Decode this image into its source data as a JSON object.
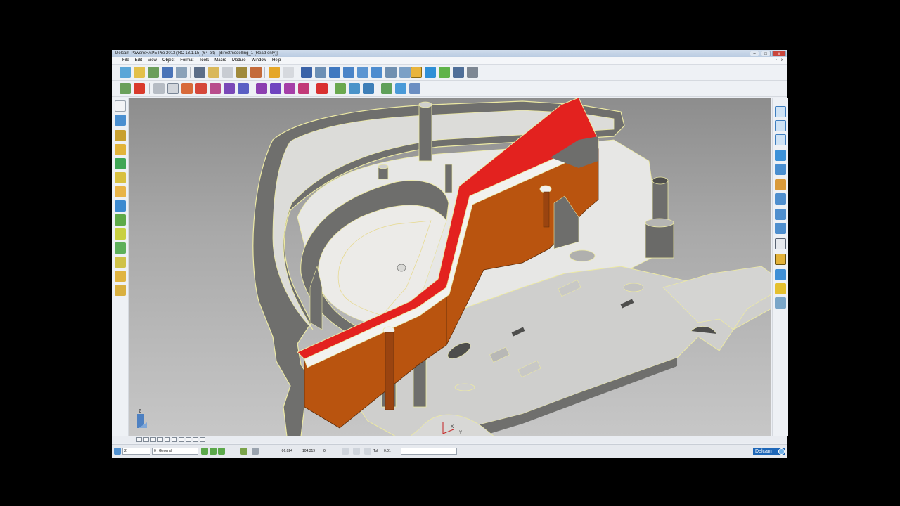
{
  "window": {
    "title": "Delcam PowerSHAPE Pro 2013 (RC 13.1.15) (64-bit) - [directmodelling_1 (Read-only)]",
    "minimize": "–",
    "maximize": "□",
    "close": "x",
    "mdi_controls": "- ▫ x"
  },
  "menu": [
    "File",
    "Edit",
    "View",
    "Object",
    "Format",
    "Tools",
    "Macro",
    "Module",
    "Window",
    "Help"
  ],
  "status": {
    "level": "2",
    "layer": "0 : General",
    "x": "-96.024",
    "y": "104.319",
    "z": "0",
    "tol_label": "Tol",
    "tol_value": "0.01",
    "brand": "Delcam"
  },
  "axis_labels": {
    "z": "Z",
    "x": "X",
    "y": "Y"
  },
  "colors": {
    "highlight_top": "#e3221f",
    "highlight_side": "#b9540f",
    "part_top": "#d6d6d4",
    "part_wall": "#6e6e6c",
    "edge": "#e9e6a0",
    "background": "#a9a9a9"
  }
}
